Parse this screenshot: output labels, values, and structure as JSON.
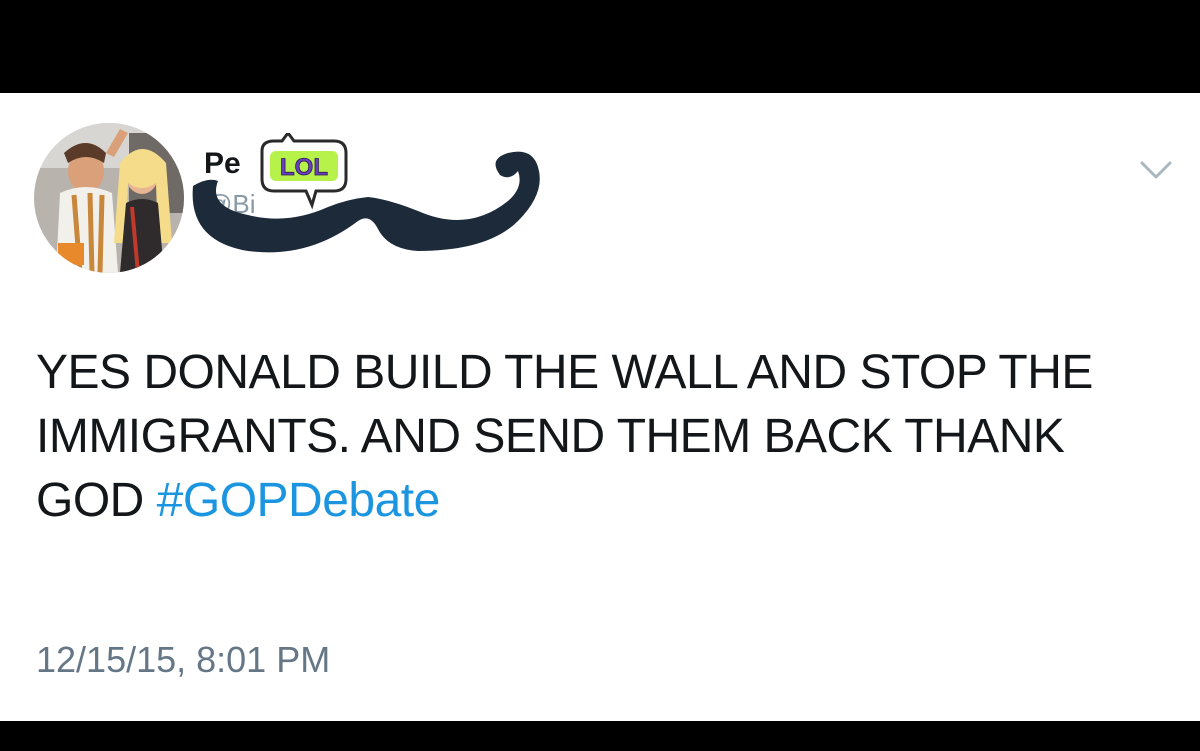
{
  "user": {
    "display_name": "Pe",
    "handle": "@Bi",
    "avatar_alt": "profile photo",
    "sticker_text": "LOL",
    "overlay_icon": "mustache-icon"
  },
  "tweet": {
    "text_part1": "YES DONALD BUILD THE WALL AND STOP THE IMMIGRANTS. AND SEND THEM BACK THANK GOD ",
    "hashtag": "#GOPDebate",
    "timestamp": "12/15/15, 8:01 PM"
  },
  "controls": {
    "menu_icon": "chevron-down-icon"
  },
  "colors": {
    "text": "#14171a",
    "link": "#1b95e0",
    "muted": "#657786",
    "mustache": "#1c2a3a",
    "sticker_fill": "#b7f24a",
    "sticker_text": "#6a3fbf"
  }
}
